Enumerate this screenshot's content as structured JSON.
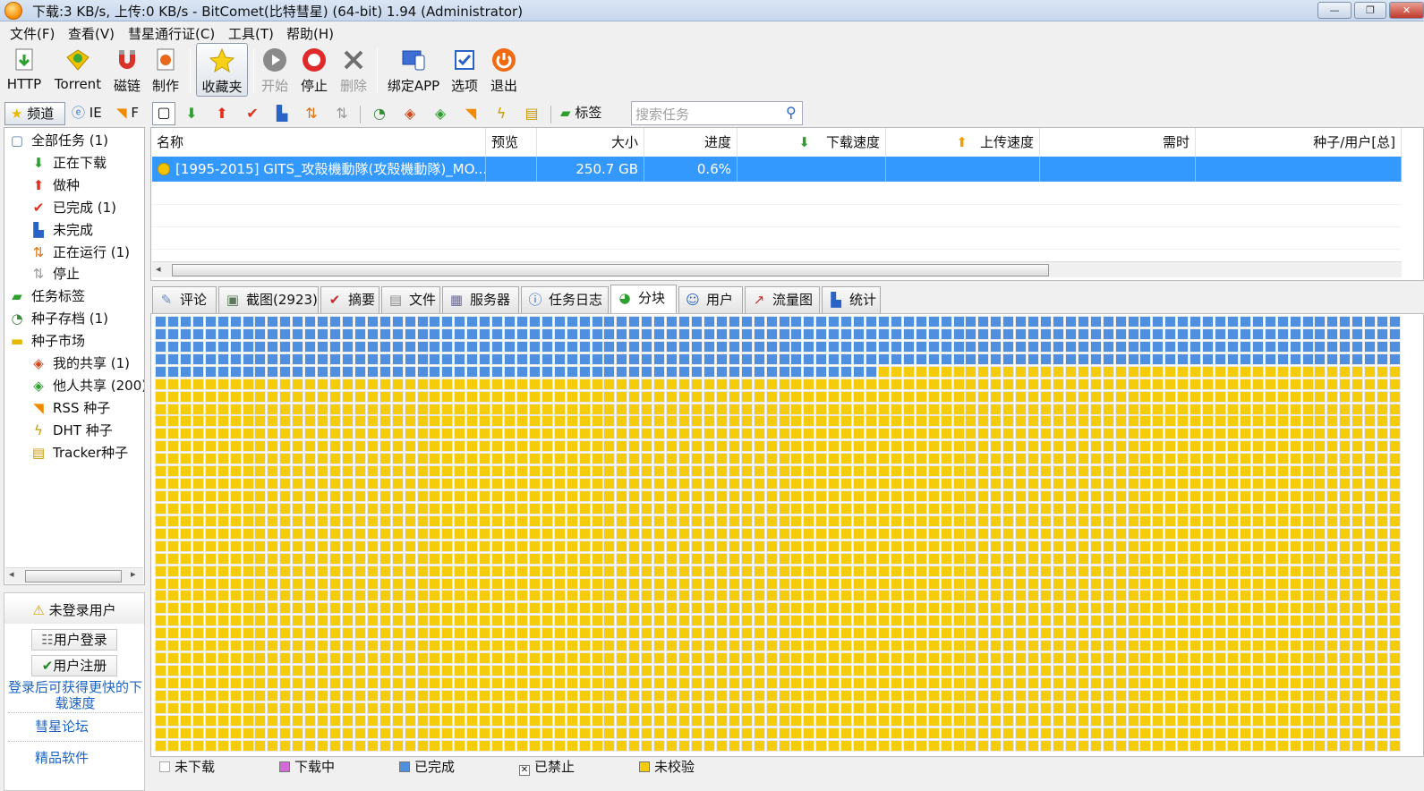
{
  "window": {
    "title": "下载:3 KB/s, 上传:0 KB/s - BitComet(比特彗星) (64-bit) 1.94 (Administrator)"
  },
  "menu": [
    "文件(F)",
    "查看(V)",
    "彗星通行证(C)",
    "工具(T)",
    "帮助(H)"
  ],
  "toolbar": [
    {
      "label": "HTTP",
      "icon": "http-download-icon",
      "enabled": true
    },
    {
      "label": "Torrent",
      "icon": "torrent-icon",
      "enabled": true
    },
    {
      "label": "磁链",
      "icon": "magnet-icon",
      "enabled": true
    },
    {
      "label": "制作",
      "icon": "make-torrent-icon",
      "enabled": true
    },
    {
      "label": "收藏夹",
      "icon": "favorites-star-icon",
      "enabled": true,
      "active": true
    },
    {
      "label": "开始",
      "icon": "start-icon",
      "enabled": false
    },
    {
      "label": "停止",
      "icon": "stop-icon",
      "enabled": true
    },
    {
      "label": "删除",
      "icon": "delete-icon",
      "enabled": false
    },
    {
      "label": "绑定APP",
      "icon": "bind-app-icon",
      "enabled": true
    },
    {
      "label": "选项",
      "icon": "options-icon",
      "enabled": true
    },
    {
      "label": "退出",
      "icon": "exit-icon",
      "enabled": true
    }
  ],
  "channel_tabs": {
    "channels": "频道",
    "ie": "IE",
    "rss": "F"
  },
  "filter_tag_label": "标签",
  "search": {
    "placeholder": "搜索任务"
  },
  "sidebar": [
    {
      "label": "全部任务 (1)",
      "icon": "all-tasks-icon",
      "level": 0
    },
    {
      "label": "正在下载",
      "icon": "downloading-icon",
      "level": 1
    },
    {
      "label": "做种",
      "icon": "seeding-icon",
      "level": 1
    },
    {
      "label": "已完成 (1)",
      "icon": "completed-icon",
      "level": 1
    },
    {
      "label": "未完成",
      "icon": "incomplete-icon",
      "level": 1
    },
    {
      "label": "正在运行 (1)",
      "icon": "running-icon",
      "level": 1
    },
    {
      "label": "停止",
      "icon": "stopped-icon",
      "level": 1
    },
    {
      "label": "任务标签",
      "icon": "task-tags-icon",
      "level": 0
    },
    {
      "label": "种子存档 (1)",
      "icon": "torrent-archive-icon",
      "level": 0
    },
    {
      "label": "种子市场",
      "icon": "torrent-market-icon",
      "level": 0
    },
    {
      "label": "我的共享 (1)",
      "icon": "my-share-icon",
      "level": 1
    },
    {
      "label": "他人共享 (200)",
      "icon": "others-share-icon",
      "level": 1
    },
    {
      "label": "RSS 种子",
      "icon": "rss-icon",
      "level": 1
    },
    {
      "label": "DHT 种子",
      "icon": "dht-icon",
      "level": 1
    },
    {
      "label": "Tracker种子",
      "icon": "tracker-icon",
      "level": 1
    }
  ],
  "login": {
    "status": "未登录用户",
    "login_button": "用户登录",
    "register_button": "用户注册",
    "promo": "登录后可获得更快的下载速度",
    "forum": "彗星论坛",
    "software": "精品软件"
  },
  "task_columns": [
    "名称",
    "预览",
    "大小",
    "进度",
    "下载速度",
    "上传速度",
    "需时",
    "种子/用户[总]"
  ],
  "tasks": [
    {
      "name": "[1995-2015] GITS_攻殻機動隊(攻殻機動隊)_MO...",
      "preview": "",
      "size": "250.7 GB",
      "progress": "0.6%",
      "down_speed": "",
      "up_speed": "",
      "eta": "",
      "peers": ""
    }
  ],
  "detail_tabs": [
    {
      "label": "评论",
      "icon": "comment-icon"
    },
    {
      "label": "截图(2923)",
      "icon": "screenshot-icon"
    },
    {
      "label": "摘要",
      "icon": "summary-icon"
    },
    {
      "label": "文件",
      "icon": "files-icon"
    },
    {
      "label": "服务器",
      "icon": "server-icon"
    },
    {
      "label": "任务日志",
      "icon": "info-icon"
    },
    {
      "label": "分块",
      "icon": "pieces-icon",
      "selected": true
    },
    {
      "label": "用户",
      "icon": "users-icon"
    },
    {
      "label": "流量图",
      "icon": "traffic-chart-icon"
    },
    {
      "label": "统计",
      "icon": "stats-icon"
    }
  ],
  "piece_map": {
    "columns": 100,
    "rows": 35,
    "completed_cells": 458,
    "completed_color": "#4f8fe0",
    "unverified_color": "#f5cc0a"
  },
  "legend": [
    {
      "label": "未下载",
      "color": "#ffffff"
    },
    {
      "label": "下载中",
      "color": "#d36ad8"
    },
    {
      "label": "已完成",
      "color": "#4f8fe0"
    },
    {
      "label": "已禁止",
      "color": "#ffffff"
    },
    {
      "label": "未校验",
      "color": "#f5cc0a"
    }
  ]
}
